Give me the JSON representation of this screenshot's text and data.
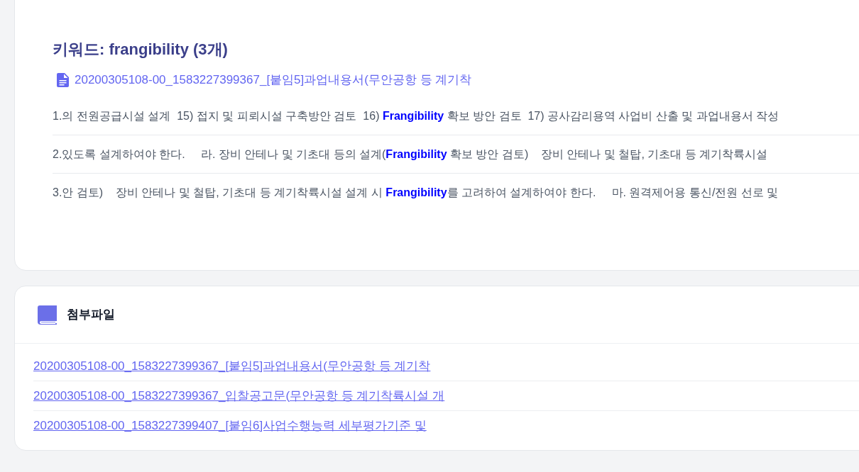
{
  "keyword_result": {
    "heading": "키워드: frangibility (3개)",
    "file_link": "20200305108-00_1583227399367_[붙임5]과업내용서(무안공항 등 계기착",
    "snippets": [
      "1.의 전원공급시설 설계  15) 접지 및 피뢰시설 구축방안 검토  16) **Frangibility** 확보 방안 검토  17) 공사감리용역 사업비 산출 및 과업내용서 작성",
      "2.있도록 설계하여야 한다.     라. 장비 안테나 및 기초대 등의 설계(**Frangibility** 확보 방안 검토)    장비 안테나 및 철탑, 기초대 등 계기착륙시설",
      "3.안 검토)    장비 안테나 및 철탑, 기초대 등 계기착륙시설 설계 시 **Frangibility**를 고려하여 설계하여야 한다.     마. 원격제어용 통신/전원 선로 및"
    ]
  },
  "attachments": {
    "title": "첨부파일",
    "files": [
      "20200305108-00_1583227399367_[붙임5]과업내용서(무안공항 등 계기착",
      "20200305108-00_1583227399367_입찰공고문(무안공항 등 계기착륙시설 개",
      "20200305108-00_1583227399407_[붙임6]사업수행능력 세부평가기준 및"
    ]
  }
}
